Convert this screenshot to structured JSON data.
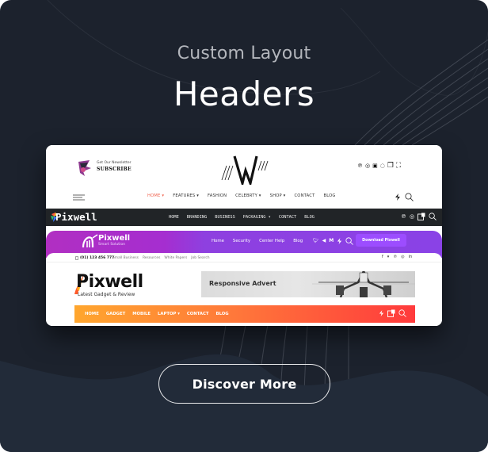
{
  "hero": {
    "subtitle": "Custom Layout",
    "title": "Headers",
    "cta_label": "Discover More"
  },
  "colors": {
    "background": "#1c222d",
    "accent_coral": "#f0634e",
    "purple_start": "#b12fc2",
    "purple_end": "#8a42e6",
    "orange_start": "#ffa62e",
    "red_end": "#ff3a3c"
  },
  "header1": {
    "newsletter_label": "Get Our Newsletter",
    "newsletter_sub": "SUBSCRIBE",
    "logo_text": "W",
    "social_icons": [
      "pinterest-icon",
      "instagram-icon",
      "youtube-icon",
      "whatsapp-icon",
      "bookmark-icon",
      "cart-icon"
    ],
    "social_glyphs": [
      "℗",
      "◎",
      "▣",
      "◌",
      "❐",
      "⛶"
    ],
    "nav": [
      {
        "label": "HOME ▾",
        "active": true
      },
      {
        "label": "FEATURES ▾",
        "active": false
      },
      {
        "label": "FASHION",
        "active": false
      },
      {
        "label": "CELEBRTY ▾",
        "active": false
      },
      {
        "label": "SHOP ▾",
        "active": false
      },
      {
        "label": "CONTACT",
        "active": false
      },
      {
        "label": "BLOG",
        "active": false
      }
    ]
  },
  "header2": {
    "logo_text": "Pixwell",
    "nav": [
      "HOME",
      "BRANDING",
      "BUSINESS",
      "PACKAGING ▾",
      "CONTACT",
      "BLOG"
    ]
  },
  "header3": {
    "logo_text": "Pixwell",
    "logo_tagline": "Smart Solution",
    "nav": [
      "Home",
      "Security",
      "Center Help",
      "Blog"
    ],
    "download_label": "Download Pixwell"
  },
  "header4": {
    "phone": "(01) 123 456 777",
    "top_links": [
      "Small Business",
      "Resources",
      "White Papers",
      "Job Search"
    ],
    "top_social": [
      "f",
      "🐦",
      "℗",
      "◎",
      "in"
    ],
    "logo_text": "Pixwell",
    "tagline": "Latest Gadget & Review",
    "advert_text": "Responsive Advert",
    "nav": [
      "HOME",
      "GADGET",
      "MOBILE",
      "LAPTOP ▾",
      "CONTACT",
      "BLOG"
    ]
  }
}
